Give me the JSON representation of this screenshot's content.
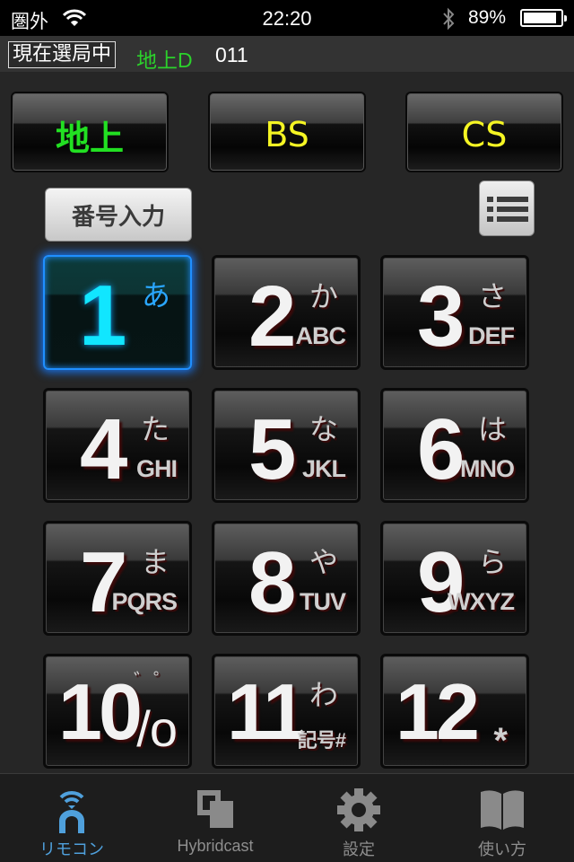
{
  "status_bar": {
    "carrier": "圏外",
    "time": "22:20",
    "battery_percent": "89%",
    "battery_level": 0.89
  },
  "channel_bar": {
    "label": "現在選局中",
    "band": "地上D",
    "channel": "011"
  },
  "band_buttons": [
    {
      "label": "地上",
      "color": "#22e022"
    },
    {
      "label": "BS",
      "color": "#f5f523"
    },
    {
      "label": "CS",
      "color": "#f5f523"
    }
  ],
  "number_input_label": "番号入力",
  "keypad": [
    {
      "digit": "1",
      "kana": "あ",
      "latin": "",
      "active": true
    },
    {
      "digit": "2",
      "kana": "か",
      "latin": "ABC"
    },
    {
      "digit": "3",
      "kana": "さ",
      "latin": "DEF"
    },
    {
      "digit": "4",
      "kana": "た",
      "latin": "GHI"
    },
    {
      "digit": "5",
      "kana": "な",
      "latin": "JKL"
    },
    {
      "digit": "6",
      "kana": "は",
      "latin": "MNO"
    },
    {
      "digit": "7",
      "kana": "ま",
      "latin": "PQRS"
    },
    {
      "digit": "8",
      "kana": "や",
      "latin": "TUV"
    },
    {
      "digit": "9",
      "kana": "ら",
      "latin": "WXYZ"
    },
    {
      "digit": "10",
      "kana": "゛゜",
      "latin": "/o"
    },
    {
      "digit": "11",
      "kana": "わ",
      "latin": "記号#"
    },
    {
      "digit": "12",
      "kana": "",
      "latin": "*"
    }
  ],
  "tabs": [
    {
      "label": "リモコン",
      "icon": "remote-icon",
      "active": true
    },
    {
      "label": "Hybridcast",
      "icon": "hybridcast-icon"
    },
    {
      "label": "設定",
      "icon": "gear-icon"
    },
    {
      "label": "使い方",
      "icon": "book-icon"
    }
  ],
  "colors": {
    "active_blue": "#1f8fff",
    "active_digit": "#11e6ff",
    "tab_active": "#4fa0dc"
  }
}
